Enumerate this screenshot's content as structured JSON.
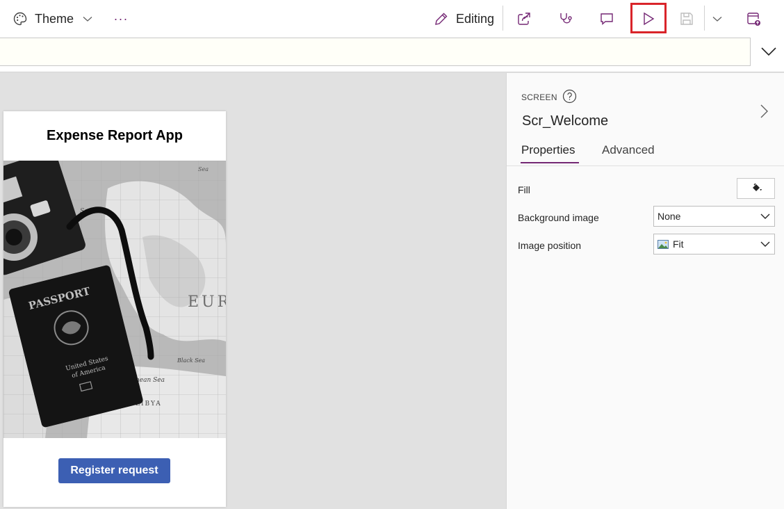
{
  "toolbar": {
    "theme_label": "Theme",
    "more_label": "···",
    "editing_label": "Editing"
  },
  "canvas": {
    "app_title": "Expense Report App",
    "register_button": "Register request"
  },
  "properties_pane": {
    "section_label": "SCREEN",
    "screen_name": "Scr_Welcome",
    "tabs": [
      {
        "label": "Properties",
        "active": true
      },
      {
        "label": "Advanced",
        "active": false
      }
    ],
    "fill_label": "Fill",
    "background_image_label": "Background image",
    "background_image_value": "None",
    "image_position_label": "Image position",
    "image_position_value": "Fit"
  },
  "colors": {
    "accent": "#742774",
    "highlight_border": "#d9242a",
    "button_blue": "#3c5fb3",
    "canvas_bg": "#e1e1e1"
  },
  "icons": [
    "palette-icon",
    "chevron-down-icon",
    "pencil-icon",
    "share-icon",
    "stethoscope-icon",
    "comment-icon",
    "play-icon",
    "save-icon",
    "publish-icon",
    "help-icon",
    "chevron-right-icon",
    "paint-bucket-icon",
    "image-icon"
  ]
}
